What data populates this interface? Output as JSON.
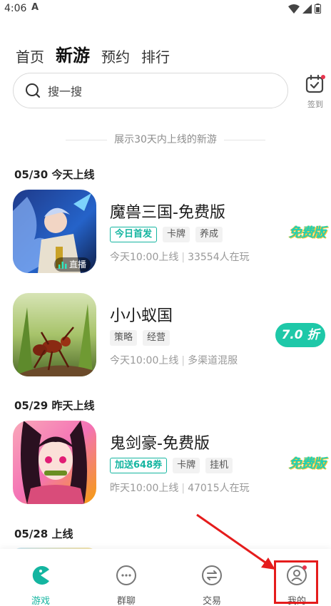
{
  "status_bar": {
    "time": "4:06",
    "app_indicator": "A"
  },
  "top_tabs": [
    {
      "label": "首页",
      "active": false
    },
    {
      "label": "新游",
      "active": true
    },
    {
      "label": "预约",
      "active": false
    },
    {
      "label": "排行",
      "active": false
    }
  ],
  "search": {
    "placeholder": "搜一搜",
    "icon": "search-icon"
  },
  "checkin": {
    "label": "签到",
    "icon": "calendar-check-icon"
  },
  "divider_note": "展示30天内上线的新游",
  "sections": [
    {
      "title": "05/30 今天上线"
    },
    {
      "title": "05/29 昨天上线"
    },
    {
      "title": "05/28 上线"
    }
  ],
  "games": [
    {
      "name": "魔兽三国-免费版",
      "tags": [
        "今日首发",
        "卡牌",
        "养成"
      ],
      "meta_time": "今天10:00上线",
      "meta_extra": "33554人在玩",
      "badge": "免费版",
      "live_label": "直播"
    },
    {
      "name": "小小蚁国",
      "tags": [
        "策略",
        "经营"
      ],
      "meta_time": "今天10:00上线",
      "meta_extra": "多渠道混服",
      "badge": "7.0 折"
    },
    {
      "name": "鬼剑豪-免费版",
      "tags": [
        "加送648券",
        "卡牌",
        "挂机"
      ],
      "meta_time": "昨天10:00上线",
      "meta_extra": "47015人在玩",
      "badge": "免费版"
    }
  ],
  "bottom_nav": [
    {
      "label": "游戏",
      "icon": "game-pacman-icon",
      "active": true
    },
    {
      "label": "群聊",
      "icon": "chat-dots-icon",
      "active": false
    },
    {
      "label": "交易",
      "icon": "exchange-icon",
      "active": false
    },
    {
      "label": "我的",
      "icon": "profile-icon",
      "active": false
    }
  ],
  "colors": {
    "accent": "#14b5a0",
    "annotation": "#e51c1c"
  }
}
